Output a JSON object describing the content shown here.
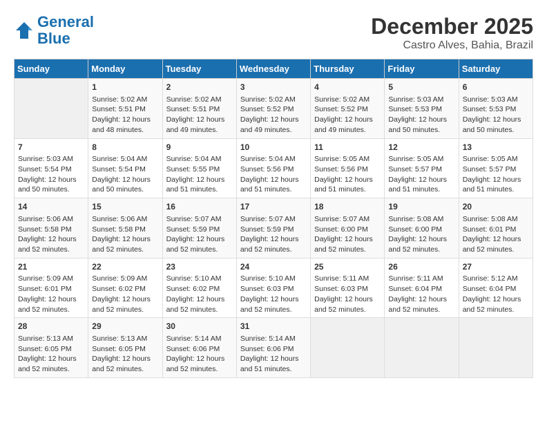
{
  "header": {
    "logo_line1": "General",
    "logo_line2": "Blue",
    "month": "December 2025",
    "location": "Castro Alves, Bahia, Brazil"
  },
  "days_of_week": [
    "Sunday",
    "Monday",
    "Tuesday",
    "Wednesday",
    "Thursday",
    "Friday",
    "Saturday"
  ],
  "weeks": [
    [
      {
        "day": "",
        "content": ""
      },
      {
        "day": "1",
        "content": "Sunrise: 5:02 AM\nSunset: 5:51 PM\nDaylight: 12 hours\nand 48 minutes."
      },
      {
        "day": "2",
        "content": "Sunrise: 5:02 AM\nSunset: 5:51 PM\nDaylight: 12 hours\nand 49 minutes."
      },
      {
        "day": "3",
        "content": "Sunrise: 5:02 AM\nSunset: 5:52 PM\nDaylight: 12 hours\nand 49 minutes."
      },
      {
        "day": "4",
        "content": "Sunrise: 5:02 AM\nSunset: 5:52 PM\nDaylight: 12 hours\nand 49 minutes."
      },
      {
        "day": "5",
        "content": "Sunrise: 5:03 AM\nSunset: 5:53 PM\nDaylight: 12 hours\nand 50 minutes."
      },
      {
        "day": "6",
        "content": "Sunrise: 5:03 AM\nSunset: 5:53 PM\nDaylight: 12 hours\nand 50 minutes."
      }
    ],
    [
      {
        "day": "7",
        "content": "Sunrise: 5:03 AM\nSunset: 5:54 PM\nDaylight: 12 hours\nand 50 minutes."
      },
      {
        "day": "8",
        "content": "Sunrise: 5:04 AM\nSunset: 5:54 PM\nDaylight: 12 hours\nand 50 minutes."
      },
      {
        "day": "9",
        "content": "Sunrise: 5:04 AM\nSunset: 5:55 PM\nDaylight: 12 hours\nand 51 minutes."
      },
      {
        "day": "10",
        "content": "Sunrise: 5:04 AM\nSunset: 5:56 PM\nDaylight: 12 hours\nand 51 minutes."
      },
      {
        "day": "11",
        "content": "Sunrise: 5:05 AM\nSunset: 5:56 PM\nDaylight: 12 hours\nand 51 minutes."
      },
      {
        "day": "12",
        "content": "Sunrise: 5:05 AM\nSunset: 5:57 PM\nDaylight: 12 hours\nand 51 minutes."
      },
      {
        "day": "13",
        "content": "Sunrise: 5:05 AM\nSunset: 5:57 PM\nDaylight: 12 hours\nand 51 minutes."
      }
    ],
    [
      {
        "day": "14",
        "content": "Sunrise: 5:06 AM\nSunset: 5:58 PM\nDaylight: 12 hours\nand 52 minutes."
      },
      {
        "day": "15",
        "content": "Sunrise: 5:06 AM\nSunset: 5:58 PM\nDaylight: 12 hours\nand 52 minutes."
      },
      {
        "day": "16",
        "content": "Sunrise: 5:07 AM\nSunset: 5:59 PM\nDaylight: 12 hours\nand 52 minutes."
      },
      {
        "day": "17",
        "content": "Sunrise: 5:07 AM\nSunset: 5:59 PM\nDaylight: 12 hours\nand 52 minutes."
      },
      {
        "day": "18",
        "content": "Sunrise: 5:07 AM\nSunset: 6:00 PM\nDaylight: 12 hours\nand 52 minutes."
      },
      {
        "day": "19",
        "content": "Sunrise: 5:08 AM\nSunset: 6:00 PM\nDaylight: 12 hours\nand 52 minutes."
      },
      {
        "day": "20",
        "content": "Sunrise: 5:08 AM\nSunset: 6:01 PM\nDaylight: 12 hours\nand 52 minutes."
      }
    ],
    [
      {
        "day": "21",
        "content": "Sunrise: 5:09 AM\nSunset: 6:01 PM\nDaylight: 12 hours\nand 52 minutes."
      },
      {
        "day": "22",
        "content": "Sunrise: 5:09 AM\nSunset: 6:02 PM\nDaylight: 12 hours\nand 52 minutes."
      },
      {
        "day": "23",
        "content": "Sunrise: 5:10 AM\nSunset: 6:02 PM\nDaylight: 12 hours\nand 52 minutes."
      },
      {
        "day": "24",
        "content": "Sunrise: 5:10 AM\nSunset: 6:03 PM\nDaylight: 12 hours\nand 52 minutes."
      },
      {
        "day": "25",
        "content": "Sunrise: 5:11 AM\nSunset: 6:03 PM\nDaylight: 12 hours\nand 52 minutes."
      },
      {
        "day": "26",
        "content": "Sunrise: 5:11 AM\nSunset: 6:04 PM\nDaylight: 12 hours\nand 52 minutes."
      },
      {
        "day": "27",
        "content": "Sunrise: 5:12 AM\nSunset: 6:04 PM\nDaylight: 12 hours\nand 52 minutes."
      }
    ],
    [
      {
        "day": "28",
        "content": "Sunrise: 5:13 AM\nSunset: 6:05 PM\nDaylight: 12 hours\nand 52 minutes."
      },
      {
        "day": "29",
        "content": "Sunrise: 5:13 AM\nSunset: 6:05 PM\nDaylight: 12 hours\nand 52 minutes."
      },
      {
        "day": "30",
        "content": "Sunrise: 5:14 AM\nSunset: 6:06 PM\nDaylight: 12 hours\nand 52 minutes."
      },
      {
        "day": "31",
        "content": "Sunrise: 5:14 AM\nSunset: 6:06 PM\nDaylight: 12 hours\nand 51 minutes."
      },
      {
        "day": "",
        "content": ""
      },
      {
        "day": "",
        "content": ""
      },
      {
        "day": "",
        "content": ""
      }
    ]
  ]
}
